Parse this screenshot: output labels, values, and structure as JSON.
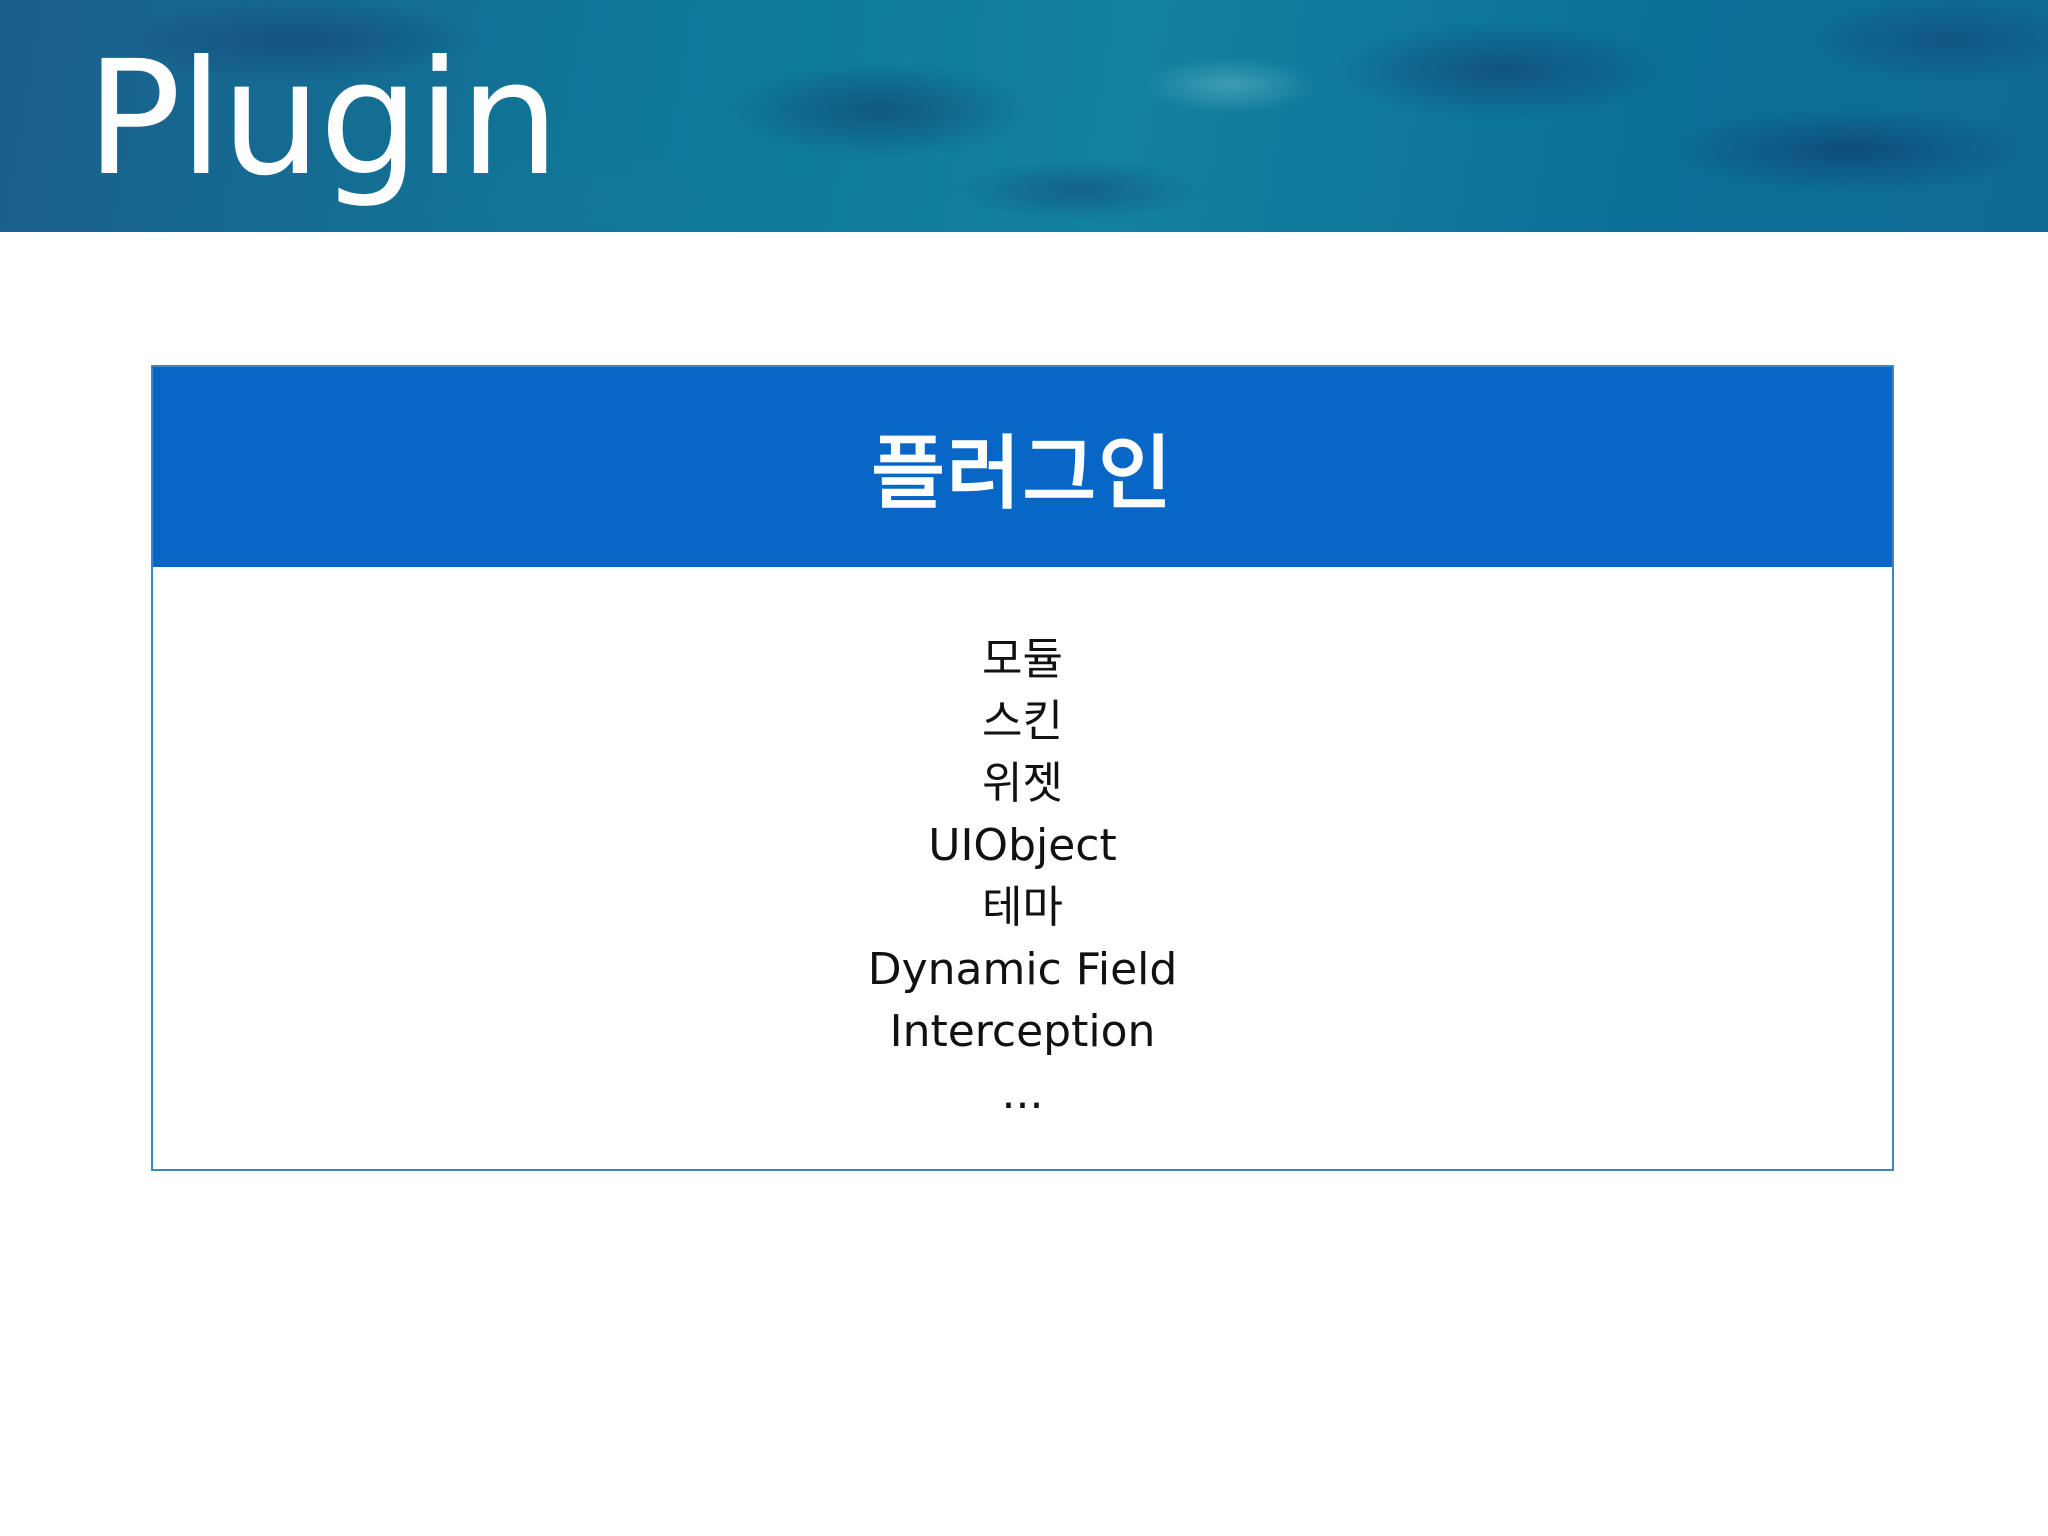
{
  "slide": {
    "title": "Plugin"
  },
  "card": {
    "header": "플러그인",
    "items": [
      "모듈",
      "스킨",
      "위젯",
      "UIObject",
      "테마",
      "Dynamic Field",
      "Interception",
      "..."
    ]
  },
  "colors": {
    "banner": "#0d7a9a",
    "header_bg": "#0766c6",
    "border": "#3b86c6"
  }
}
